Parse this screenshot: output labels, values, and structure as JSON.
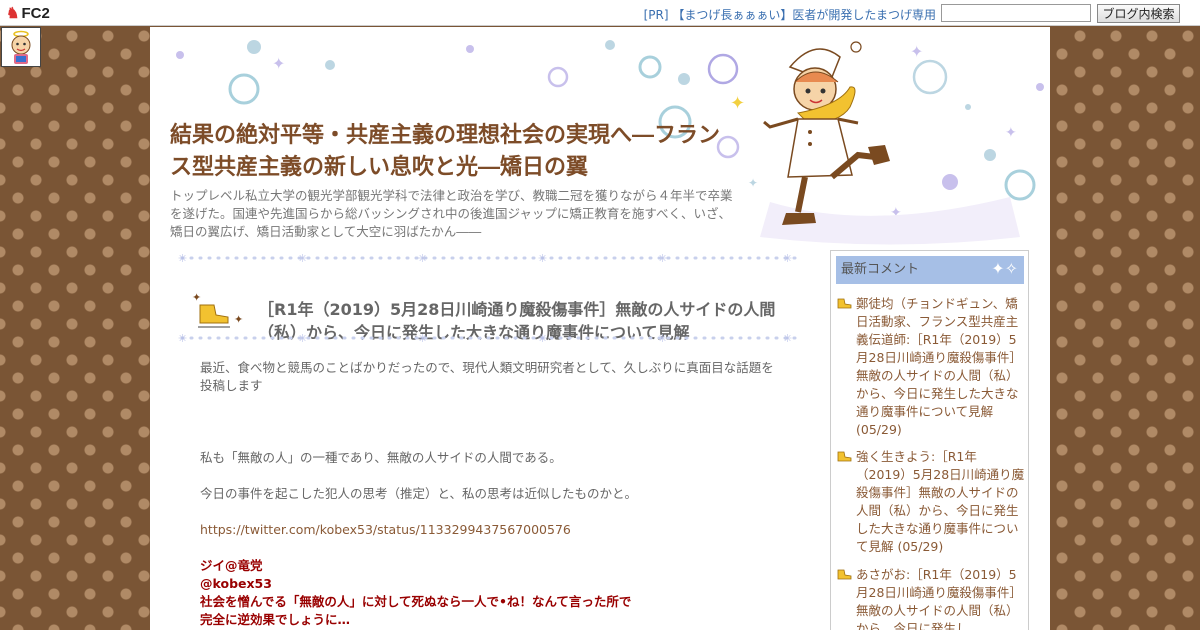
{
  "topbar": {
    "logo": "FC2",
    "ad_text": "[PR] 【まつげ長ぁぁぁい】医者が開発したまつげ専用",
    "search_placeholder": "",
    "search_button": "ブログ内検索"
  },
  "blog": {
    "title": "結果の絶対平等・共産主義の理想社会の実現へ―フランス型共産主義の新しい息吹と光―矯日の翼",
    "description": "トップレベル私立大学の観光学部観光学科で法律と政治を学び、教職二冠を獲りながら４年半で卒業を遂げた。国連や先進国らから総バッシングされ中の後進国ジャップに矯正教育を施すべく、いざ、矯日の翼広げ、矯日活動家として大空に羽ばたかん――"
  },
  "post": {
    "title": "［R1年（2019）5月28日川崎通り魔殺傷事件］無敵の人サイドの人間（私）から、今日に発生した大きな通り魔事件について見解",
    "intro": "最近、食べ物と競馬のことばかりだったので、現代人類文明研究者として、久しぶりに真面目な話題を投稿します",
    "para1": "私も「無敵の人」の一種であり、無敵の人サイドの人間である。",
    "para2": "今日の事件を起こした犯人の思考（推定）と、私の思考は近似したものかと。",
    "link": "https://twitter.com/kobex53/status/1133299437567000576",
    "quote_name": "ジイ@竜党",
    "quote_handle": "@kobex53",
    "quote_line1": "社会を憎んでる「無敵の人」に対して死ぬなら一人で•ね！なんて言った所で",
    "quote_line2": "完全に逆効果でしょうに…"
  },
  "sidebar": {
    "header": "最新コメント",
    "comments": [
      {
        "text": "鄭徒均（チョンドギュン、矯日活動家、フランス型共産主義伝道師:［R1年（2019）5月28日川崎通り魔殺傷事件］無敵の人サイドの人間（私）から、今日に発生した大きな通り魔事件について見解 (05/29)"
      },
      {
        "text": "強く生きよう:［R1年（2019）5月28日川崎通り魔殺傷事件］無敵の人サイドの人間（私）から、今日に発生した大きな通り魔事件について見解 (05/29)"
      },
      {
        "text": "あさがお:［R1年（2019）5月28日川崎通り魔殺傷事件］無敵の人サイドの人間（私）から、今日に発生し"
      }
    ]
  },
  "colors": {
    "title": "#7d4c28",
    "sidebar_header": "#a6bfe6",
    "quote": "#990000",
    "background": "#7a5535"
  }
}
